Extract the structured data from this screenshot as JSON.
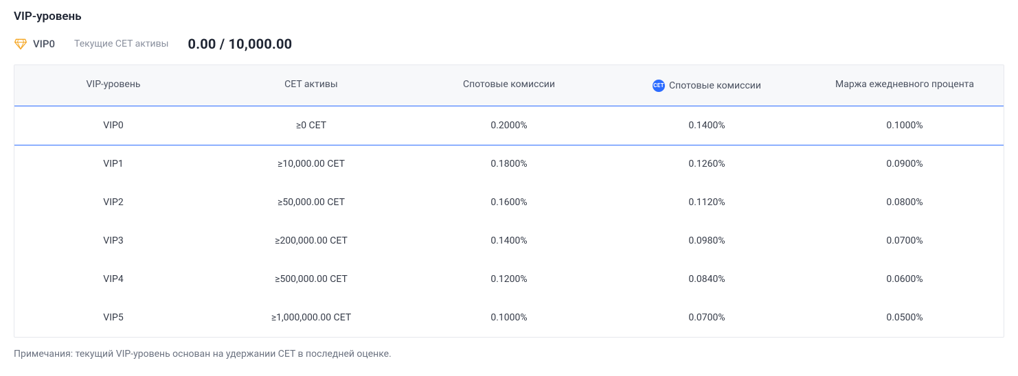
{
  "title": "VIP-уровень",
  "status": {
    "vip_level": "VIP0",
    "assets_label": "Текущие CET активы",
    "assets_value": "0.00 / 10,000.00"
  },
  "table": {
    "headers": {
      "level": "VIP-уровень",
      "cet_assets": "CET активы",
      "spot_fee": "Спотовые комиссии",
      "spot_fee_cet": "Спотовые комиссии",
      "margin_daily": "Маржа ежедневного процента"
    },
    "cet_badge_text": "CET",
    "rows": [
      {
        "level": "VIP0",
        "cet": "≥0 CET",
        "spot": "0.2000%",
        "spot_cet": "0.1400%",
        "margin": "0.1000%",
        "active": true
      },
      {
        "level": "VIP1",
        "cet": "≥10,000.00 CET",
        "spot": "0.1800%",
        "spot_cet": "0.1260%",
        "margin": "0.0900%",
        "active": false
      },
      {
        "level": "VIP2",
        "cet": "≥50,000.00 CET",
        "spot": "0.1600%",
        "spot_cet": "0.1120%",
        "margin": "0.0800%",
        "active": false
      },
      {
        "level": "VIP3",
        "cet": "≥200,000.00 CET",
        "spot": "0.1400%",
        "spot_cet": "0.0980%",
        "margin": "0.0700%",
        "active": false
      },
      {
        "level": "VIP4",
        "cet": "≥500,000.00 CET",
        "spot": "0.1200%",
        "spot_cet": "0.0840%",
        "margin": "0.0600%",
        "active": false
      },
      {
        "level": "VIP5",
        "cet": "≥1,000,000.00 CET",
        "spot": "0.1000%",
        "spot_cet": "0.0700%",
        "margin": "0.0500%",
        "active": false
      }
    ]
  },
  "footnote": "Примечания: текущий VIP-уровень основан на удержании CET в последней оценке."
}
